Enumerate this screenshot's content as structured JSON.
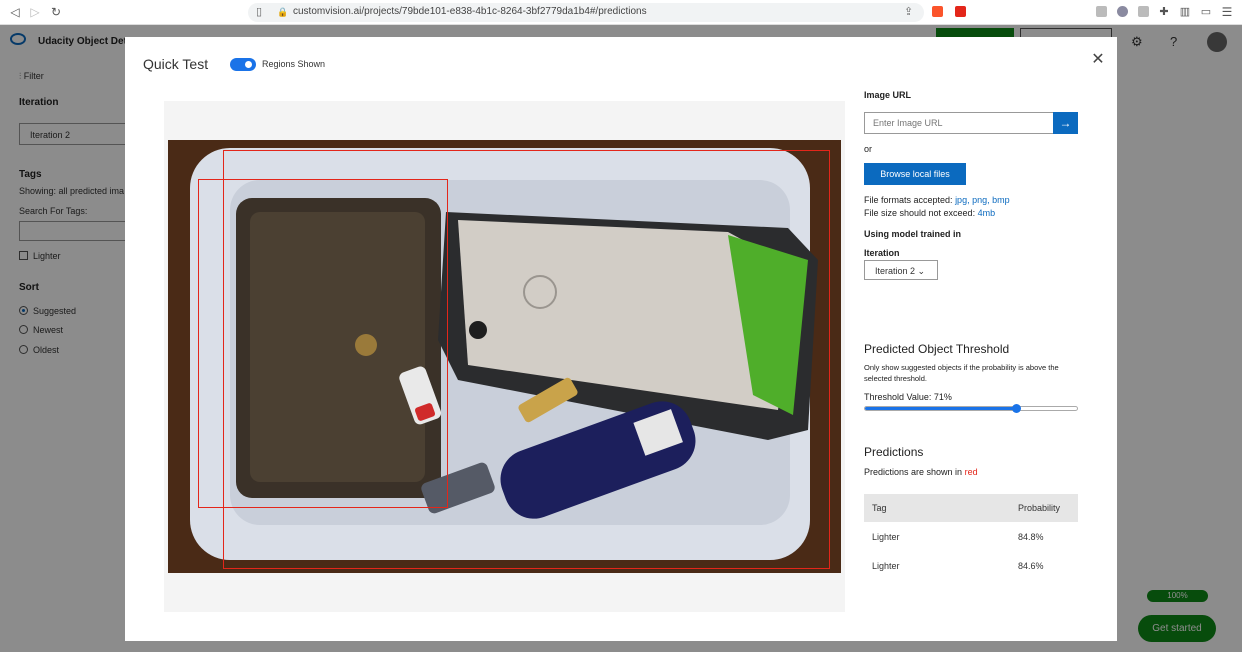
{
  "browser": {
    "url": "customvision.ai/projects/79bde101-e838-4b1c-8264-3bf2779da1b4#/predictions"
  },
  "app": {
    "title": "Udacity Object Detec",
    "sidebar": {
      "filter_label": "Filter",
      "iteration_heading": "Iteration",
      "iteration_value": "Iteration 2",
      "tags_heading": "Tags",
      "tags_showing": "Showing: all predicted ima",
      "search_tags_label": "Search For Tags:",
      "lighter_checkbox": "Lighter",
      "sort_heading": "Sort",
      "sort_options": [
        "Suggested",
        "Newest",
        "Oldest"
      ]
    },
    "progress_label": "100%",
    "get_started_label": "Get started"
  },
  "modal": {
    "title": "Quick Test",
    "regions_toggle_label": "Regions Shown",
    "close_icon": "close-icon",
    "image_url_label": "Image URL",
    "image_url_placeholder": "Enter Image URL",
    "or_label": "or",
    "browse_button": "Browse local files",
    "formats_prefix": "File formats accepted:",
    "formats": "jpg, png, bmp",
    "size_prefix": "File size should not exceed:",
    "size_limit": "4mb",
    "using_model_label": "Using model trained in",
    "iteration_label": "Iteration",
    "iteration_selected": "Iteration 2",
    "threshold_title": "Predicted Object Threshold",
    "threshold_desc_1": "Only show suggested objects if the probability is above the",
    "threshold_desc_2": "selected threshold.",
    "threshold_value_label": "Threshold Value: 71%",
    "threshold_fraction": 0.71,
    "predictions_title": "Predictions",
    "predictions_note_prefix": "Predictions are shown in",
    "predictions_note_color": "red",
    "table": {
      "headers": [
        "Tag",
        "Probability"
      ],
      "rows": [
        {
          "tag": "Lighter",
          "probability": "84.8%"
        },
        {
          "tag": "Lighter",
          "probability": "84.6%"
        }
      ]
    }
  }
}
